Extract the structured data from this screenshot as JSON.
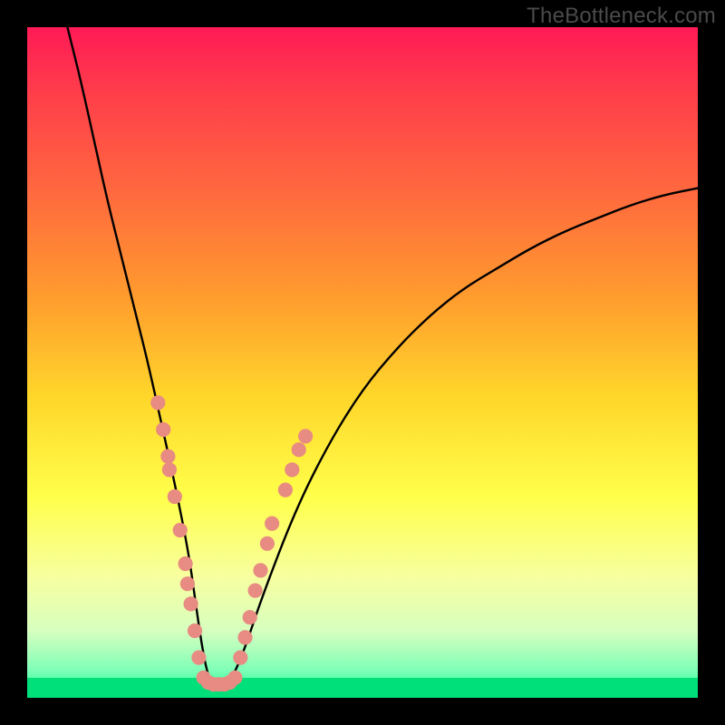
{
  "watermark": "TheBottleneck.com",
  "chart_data": {
    "type": "line",
    "title": "",
    "xlabel": "",
    "ylabel": "",
    "xlim": [
      0,
      100
    ],
    "ylim": [
      0,
      100
    ],
    "grid": false,
    "legend": false,
    "background": "vertical-gradient red→orange→yellow→green",
    "series": [
      {
        "name": "bottleneck-curve",
        "x": [
          6,
          8,
          10,
          12,
          14,
          16,
          18,
          20,
          22,
          24,
          25,
          26,
          27,
          28,
          30,
          32,
          35,
          40,
          45,
          50,
          55,
          60,
          65,
          70,
          75,
          80,
          85,
          90,
          95,
          100
        ],
        "values": [
          100,
          92,
          83,
          74,
          66,
          58,
          50,
          41,
          32,
          22,
          15,
          8,
          3,
          2,
          2,
          6,
          15,
          28,
          38,
          46,
          52,
          57,
          61,
          64,
          67,
          69.5,
          71.5,
          73.5,
          75,
          76
        ],
        "color": "#000000"
      }
    ],
    "annotations": {
      "beads_left": [
        {
          "x": 19.5,
          "y": 44
        },
        {
          "x": 20.3,
          "y": 40
        },
        {
          "x": 21.0,
          "y": 36
        },
        {
          "x": 21.2,
          "y": 34
        },
        {
          "x": 22.0,
          "y": 30
        },
        {
          "x": 22.8,
          "y": 25
        },
        {
          "x": 23.6,
          "y": 20
        },
        {
          "x": 23.9,
          "y": 17
        },
        {
          "x": 24.4,
          "y": 14
        },
        {
          "x": 25.0,
          "y": 10
        },
        {
          "x": 25.6,
          "y": 6
        }
      ],
      "beads_bottom": [
        {
          "x": 26.3,
          "y": 3
        },
        {
          "x": 27.0,
          "y": 2.3
        },
        {
          "x": 27.8,
          "y": 2
        },
        {
          "x": 28.6,
          "y": 2
        },
        {
          "x": 29.4,
          "y": 2
        },
        {
          "x": 30.2,
          "y": 2.3
        },
        {
          "x": 31.0,
          "y": 3
        }
      ],
      "beads_right": [
        {
          "x": 31.8,
          "y": 6
        },
        {
          "x": 32.5,
          "y": 9
        },
        {
          "x": 33.2,
          "y": 12
        },
        {
          "x": 34.0,
          "y": 16
        },
        {
          "x": 34.8,
          "y": 19
        },
        {
          "x": 35.8,
          "y": 23
        },
        {
          "x": 36.5,
          "y": 26
        },
        {
          "x": 38.5,
          "y": 31
        },
        {
          "x": 39.5,
          "y": 34
        },
        {
          "x": 40.5,
          "y": 37
        },
        {
          "x": 41.5,
          "y": 39
        }
      ],
      "bead_color": "#e88b82",
      "bead_radius_approx": 1.1
    }
  }
}
